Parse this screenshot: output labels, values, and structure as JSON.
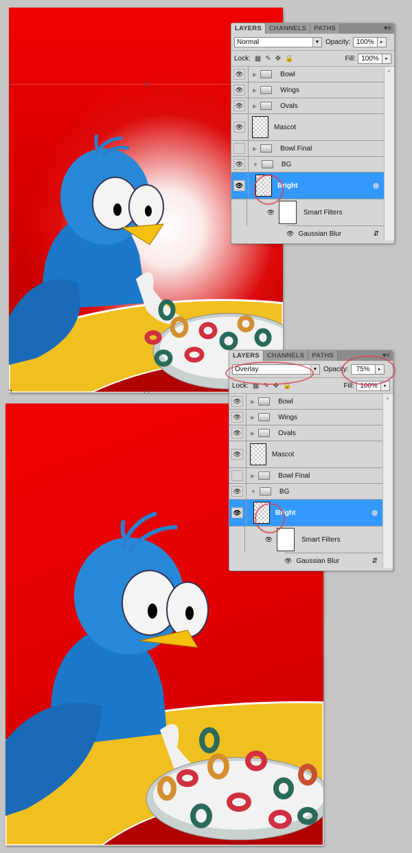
{
  "panels": [
    {
      "tabs": [
        "LAYERS",
        "CHANNELS",
        "PATHS"
      ],
      "active_tab": "LAYERS",
      "menu_icon": "panel-menu-icon",
      "blend_mode": "Normal",
      "opacity_label": "Opacity:",
      "opacity": "100%",
      "lock_label": "Lock:",
      "fill_label": "Fill:",
      "fill": "100%",
      "layers": [
        {
          "name": "Bowl",
          "type": "group",
          "visible": true,
          "expanded": false
        },
        {
          "name": "Wings",
          "type": "group",
          "visible": true,
          "expanded": false
        },
        {
          "name": "Ovals",
          "type": "group",
          "visible": true,
          "expanded": false
        },
        {
          "name": "Mascot",
          "type": "layer",
          "visible": true
        },
        {
          "name": "Bowl Final",
          "type": "group",
          "visible": false,
          "expanded": false
        },
        {
          "name": "BG",
          "type": "group",
          "visible": true,
          "expanded": true
        },
        {
          "name": "Bright",
          "type": "smart-object",
          "visible": true,
          "selected": true
        },
        {
          "name": "Smart Filters",
          "type": "smart-filters",
          "visible": true
        },
        {
          "name": "Gaussian Blur",
          "type": "filter",
          "visible": true
        }
      ]
    },
    {
      "tabs": [
        "LAYERS",
        "CHANNELS",
        "PATHS"
      ],
      "active_tab": "LAYERS",
      "menu_icon": "panel-menu-icon",
      "blend_mode": "Overlay",
      "opacity_label": "Opacity:",
      "opacity": "75%",
      "lock_label": "Lock:",
      "fill_label": "Fill:",
      "fill": "100%",
      "layers": [
        {
          "name": "Bowl",
          "type": "group",
          "visible": true,
          "expanded": false
        },
        {
          "name": "Wings",
          "type": "group",
          "visible": true,
          "expanded": false
        },
        {
          "name": "Ovals",
          "type": "group",
          "visible": true,
          "expanded": false
        },
        {
          "name": "Mascot",
          "type": "layer",
          "visible": true
        },
        {
          "name": "Bowl Final",
          "type": "group",
          "visible": false,
          "expanded": false
        },
        {
          "name": "BG",
          "type": "group",
          "visible": true,
          "expanded": true
        },
        {
          "name": "Bright",
          "type": "smart-object",
          "visible": true,
          "selected": true
        },
        {
          "name": "Smart Filters",
          "type": "smart-filters",
          "visible": true
        },
        {
          "name": "Gaussian Blur",
          "type": "filter",
          "visible": true
        }
      ]
    }
  ],
  "icons": {
    "eye": "👁",
    "triangle_right": "▶",
    "triangle_down": "▼",
    "dropdown": "▼",
    "stepper": "▸",
    "lock_transparent": "▦",
    "lock_paint": "✎",
    "lock_move": "✥",
    "lock_all": "🔒",
    "menu": "▾≡",
    "scroll_up": "▲"
  },
  "colors": {
    "selection": "#3399ff",
    "canvas_red": "#e00000",
    "annotation_ring": "#d24650"
  }
}
